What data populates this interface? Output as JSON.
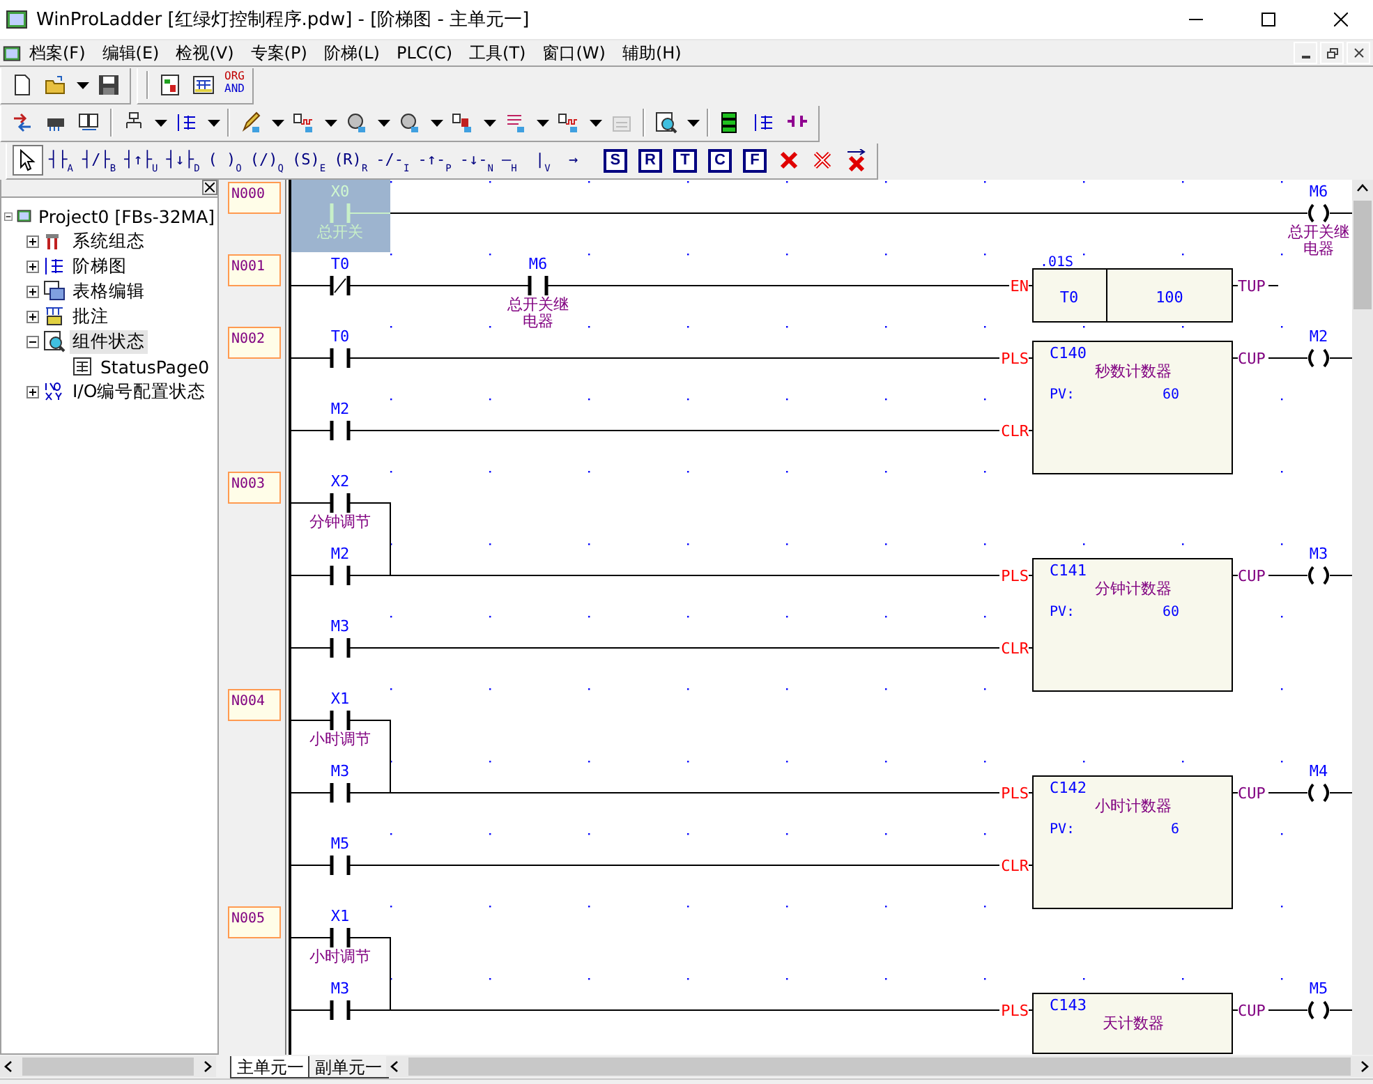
{
  "window": {
    "title": "WinProLadder [红绿灯控制程序.pdw] - [阶梯图 - 主单元一]"
  },
  "menu": [
    "档案(F)",
    "编辑(E)",
    "检视(V)",
    "专案(P)",
    "阶梯(L)",
    "PLC(C)",
    "工具(T)",
    "窗口(W)",
    "辅助(H)"
  ],
  "toolbar_file": [
    {
      "kind": "button",
      "dropdown": false
    },
    {
      "kind": "button",
      "dropdown": true
    },
    {
      "kind": "button",
      "dropdown": false
    },
    {
      "kind": "separator"
    },
    {
      "kind": "button",
      "dropdown": false
    },
    {
      "kind": "button",
      "dropdown": false
    },
    {
      "kind": "text",
      "lines": [
        "ORG",
        "AND"
      ]
    }
  ],
  "toolbar_ladder": [
    {
      "kind": "button",
      "dropdown": false,
      "disabled": false
    },
    {
      "kind": "button",
      "dropdown": false,
      "disabled": false
    },
    {
      "kind": "button",
      "dropdown": false,
      "disabled": false
    },
    {
      "kind": "separator"
    },
    {
      "kind": "button",
      "dropdown": true,
      "disabled": false
    },
    {
      "kind": "button",
      "dropdown": true,
      "disabled": false
    },
    {
      "kind": "separator"
    },
    {
      "kind": "button",
      "dropdown": true,
      "disabled": false
    },
    {
      "kind": "button",
      "dropdown": true,
      "disabled": false
    },
    {
      "kind": "button",
      "dropdown": true,
      "disabled": false
    },
    {
      "kind": "button",
      "dropdown": true,
      "disabled": false
    },
    {
      "kind": "button",
      "dropdown": true,
      "disabled": false
    },
    {
      "kind": "button",
      "dropdown": true,
      "disabled": false
    },
    {
      "kind": "button",
      "dropdown": true,
      "disabled": false
    },
    {
      "kind": "button",
      "dropdown": false,
      "disabled": true
    },
    {
      "kind": "separator"
    },
    {
      "kind": "button",
      "dropdown": true,
      "disabled": false
    },
    {
      "kind": "separator"
    },
    {
      "kind": "button",
      "dropdown": false,
      "disabled": false
    },
    {
      "kind": "button",
      "dropdown": false,
      "disabled": false
    },
    {
      "kind": "button",
      "dropdown": false,
      "disabled": false
    }
  ],
  "toolbar_edit": [
    {
      "kind": "pointer",
      "selected": true
    },
    {
      "kind": "symbol",
      "glyph": "┤├",
      "sub": "A",
      "selected": false
    },
    {
      "kind": "symbol",
      "glyph": "┤/├",
      "sub": "B",
      "selected": false
    },
    {
      "kind": "symbol",
      "glyph": "┤↑├",
      "sub": "U",
      "selected": false
    },
    {
      "kind": "symbol",
      "glyph": "┤↓├",
      "sub": "D",
      "selected": false
    },
    {
      "kind": "symbol",
      "glyph": "( )",
      "sub": "O",
      "selected": false
    },
    {
      "kind": "symbol",
      "glyph": "(/)",
      "sub": "Q",
      "selected": false
    },
    {
      "kind": "symbol",
      "glyph": "(S)",
      "sub": "E",
      "selected": false
    },
    {
      "kind": "symbol",
      "glyph": "(R)",
      "sub": "R",
      "selected": false
    },
    {
      "kind": "symbol",
      "glyph": "-/-",
      "sub": "I",
      "selected": false
    },
    {
      "kind": "symbol",
      "glyph": "-↑-",
      "sub": "P",
      "selected": false
    },
    {
      "kind": "symbol",
      "glyph": "-↓-",
      "sub": "N",
      "selected": false
    },
    {
      "kind": "symbol",
      "glyph": "—",
      "sub": "H",
      "selected": false
    },
    {
      "kind": "symbol",
      "glyph": "|",
      "sub": "V",
      "selected": false
    },
    {
      "kind": "symbol",
      "glyph": "→",
      "selected": false
    },
    {
      "kind": "letter",
      "label": "S",
      "selected": false
    },
    {
      "kind": "letter",
      "label": "R",
      "selected": false
    },
    {
      "kind": "letter",
      "label": "T",
      "selected": false
    },
    {
      "kind": "letter",
      "label": "C",
      "selected": false
    },
    {
      "kind": "letter",
      "label": "F",
      "selected": false
    },
    {
      "kind": "delete",
      "selected": false
    },
    {
      "kind": "delete",
      "selected": false
    },
    {
      "kind": "delete",
      "selected": false
    }
  ],
  "tree": {
    "label": "Project0 [FBs-32MA]",
    "expanded": true,
    "selected": false,
    "children": [
      {
        "label": "系统组态",
        "expanded": false,
        "selected": false
      },
      {
        "label": "阶梯图",
        "expanded": false,
        "selected": false
      },
      {
        "label": "表格编辑",
        "expanded": false,
        "selected": false
      },
      {
        "label": "批注",
        "expanded": false,
        "selected": false
      },
      {
        "label": "组件状态",
        "expanded": true,
        "selected": true,
        "children": [
          {
            "label": "StatusPage0",
            "selected": false
          }
        ]
      },
      {
        "label": "I/O编号配置状态",
        "expanded": false,
        "selected": false
      }
    ]
  },
  "networks": [
    {
      "number": "N000",
      "lines": [
        {
          "contacts": [
            {
              "kind": "no",
              "address": "X0",
              "comment": "总开关",
              "selected": true
            }
          ]
        }
      ],
      "coil": {
        "address": "M6",
        "comment": "总开关继电器"
      }
    },
    {
      "number": "N001",
      "lines": [
        {
          "contacts": [
            {
              "kind": "nc",
              "address": "T0",
              "selected": false
            },
            {
              "kind": "no",
              "address": "M6",
              "comment": "总开关继电器",
              "selected": false
            }
          ],
          "pin": "EN"
        }
      ],
      "block": {
        "kind": "timer",
        "base": ".01S",
        "name": "T0",
        "preset": "100",
        "output": "TUP"
      }
    },
    {
      "number": "N002",
      "lines": [
        {
          "contacts": [
            {
              "kind": "no",
              "address": "T0",
              "selected": false
            }
          ],
          "pin": "PLS"
        },
        {
          "contacts": [
            {
              "kind": "no",
              "address": "M2",
              "selected": false
            }
          ],
          "pin": "CLR"
        }
      ],
      "block": {
        "kind": "counter",
        "name": "C140",
        "comment": "秒数计数器",
        "pv_label": "PV:",
        "pv": "60",
        "output": "CUP"
      },
      "coil": {
        "address": "M2"
      }
    },
    {
      "number": "N003",
      "lines": [
        {
          "contacts": [
            {
              "kind": "no",
              "address": "X2",
              "comment": "分钟调节",
              "selected": false
            }
          ],
          "joins_next": true
        },
        {
          "contacts": [
            {
              "kind": "no",
              "address": "M2",
              "selected": false
            }
          ],
          "pin": "PLS"
        },
        {
          "contacts": [
            {
              "kind": "no",
              "address": "M3",
              "selected": false
            }
          ],
          "pin": "CLR"
        }
      ],
      "block": {
        "kind": "counter",
        "name": "C141",
        "comment": "分钟计数器",
        "pv_label": "PV:",
        "pv": "60",
        "output": "CUP"
      },
      "coil": {
        "address": "M3"
      }
    },
    {
      "number": "N004",
      "lines": [
        {
          "contacts": [
            {
              "kind": "no",
              "address": "X1",
              "comment": "小时调节",
              "selected": false
            }
          ],
          "joins_next": true
        },
        {
          "contacts": [
            {
              "kind": "no",
              "address": "M3",
              "selected": false
            }
          ],
          "pin": "PLS"
        },
        {
          "contacts": [
            {
              "kind": "no",
              "address": "M5",
              "selected": false
            }
          ],
          "pin": "CLR"
        }
      ],
      "block": {
        "kind": "counter",
        "name": "C142",
        "comment": "小时计数器",
        "pv_label": "PV:",
        "pv": "6",
        "output": "CUP"
      },
      "coil": {
        "address": "M4"
      }
    },
    {
      "number": "N005",
      "lines": [
        {
          "contacts": [
            {
              "kind": "no",
              "address": "X1",
              "comment": "小时调节",
              "selected": false
            }
          ],
          "joins_next": true
        },
        {
          "contacts": [
            {
              "kind": "no",
              "address": "M3",
              "selected": false
            }
          ],
          "pin": "PLS"
        }
      ],
      "block": {
        "kind": "counter",
        "name": "C143",
        "comment": "天计数器",
        "output": "CUP"
      },
      "coil": {
        "address": "M5"
      }
    }
  ],
  "sheet_tabs": [
    {
      "label": "主单元一",
      "selected": true
    },
    {
      "label": "副单元一",
      "selected": false
    }
  ]
}
